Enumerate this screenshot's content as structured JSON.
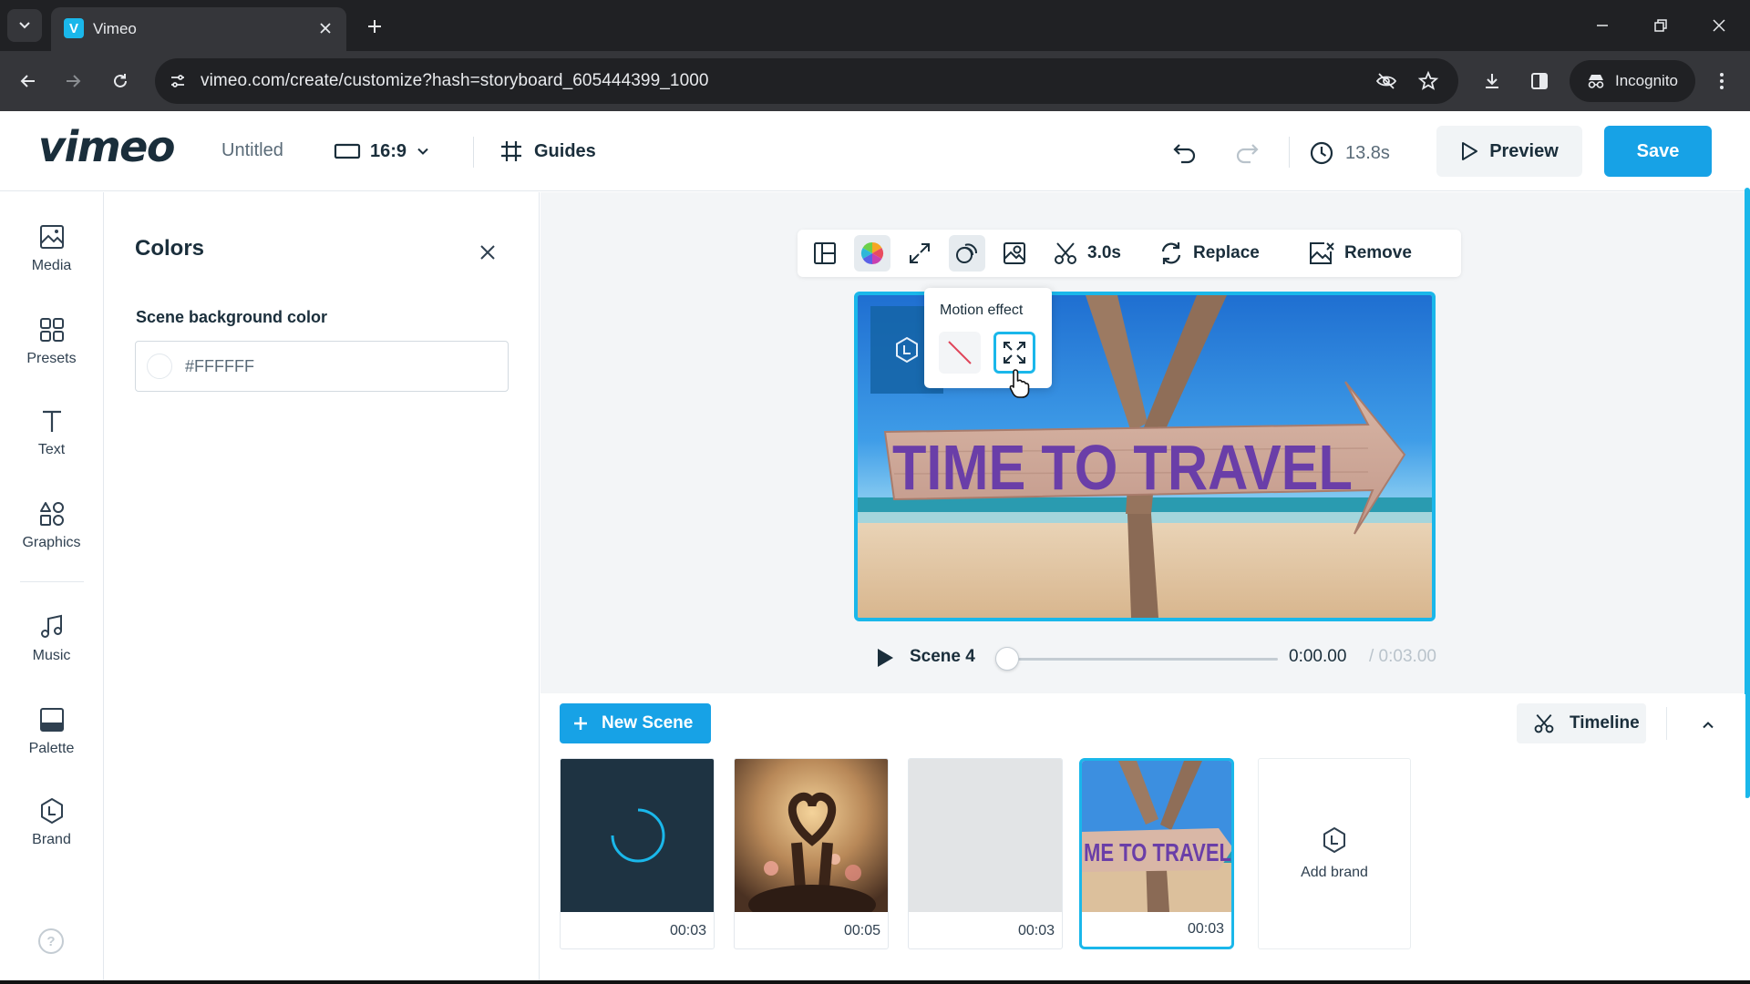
{
  "browser": {
    "tab_title": "Vimeo",
    "favicon_letter": "V",
    "url": "vimeo.com/create/customize?hash=storyboard_605444399_1000",
    "profile_label": "Incognito"
  },
  "header": {
    "logo_text": "vimeo",
    "project_title": "Untitled",
    "aspect_ratio": "16:9",
    "guides_label": "Guides",
    "duration": "13.8s",
    "preview_label": "Preview",
    "save_label": "Save"
  },
  "sidebar": {
    "items": [
      {
        "label": "Media",
        "icon": "image-icon"
      },
      {
        "label": "Presets",
        "icon": "grid-icon"
      },
      {
        "label": "Text",
        "icon": "text-icon"
      },
      {
        "label": "Graphics",
        "icon": "shapes-icon"
      },
      {
        "label": "Music",
        "icon": "music-note-icon"
      },
      {
        "label": "Palette",
        "icon": "palette-icon"
      },
      {
        "label": "Brand",
        "icon": "brand-hexagon-icon"
      }
    ],
    "help_label": "?"
  },
  "colors_panel": {
    "title": "Colors",
    "field_label": "Scene background color",
    "color_value": "#FFFFFF"
  },
  "media_toolbar": {
    "trim_duration": "3.0s",
    "replace_label": "Replace",
    "remove_label": "Remove"
  },
  "motion_popover": {
    "title": "Motion effect"
  },
  "scene_image": {
    "sign_text": "TIME TO TRAVEL",
    "sign_text_cropped": "ME TO TRAVEL"
  },
  "player": {
    "scene_label": "Scene 4",
    "current_time": "0:00.00",
    "total_time": "/ 0:03.00",
    "progress": 0
  },
  "storyboard": {
    "new_scene_label": "New Scene",
    "timeline_label": "Timeline",
    "scenes": [
      {
        "duration": "00:03"
      },
      {
        "duration": "00:05"
      },
      {
        "duration": "00:03"
      },
      {
        "duration": "00:03"
      }
    ],
    "add_brand_label": "Add brand"
  },
  "colors": {
    "accent": "#17a2e6",
    "selection": "#1ab7ea",
    "text_dark": "#1a2e3b"
  }
}
